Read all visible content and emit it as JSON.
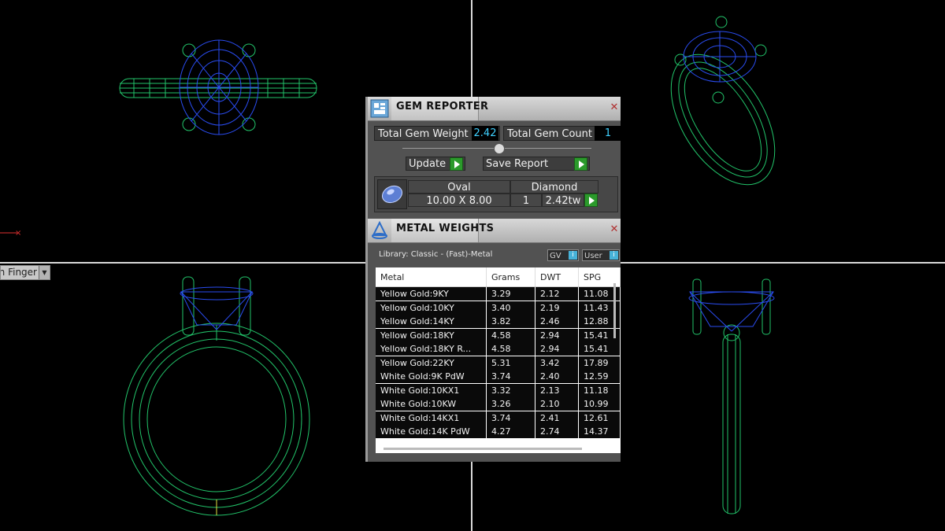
{
  "viewport": {
    "label": "h Finger"
  },
  "gem_reporter": {
    "title": "GEM REPORTER",
    "total_weight_label": "Total Gem Weight",
    "total_weight_value": "2.42",
    "total_count_label": "Total Gem Count",
    "total_count_value": "1",
    "update_label": "Update",
    "save_report_label": "Save Report",
    "gem": {
      "shape": "Oval",
      "type": "Diamond",
      "size": "10.00 X 8.00",
      "qty": "1",
      "weight": "2.42tw"
    }
  },
  "metal_weights": {
    "title": "METAL WEIGHTS",
    "library": "Library: Classic - (Fast)-Metal",
    "gv_label": "GV",
    "user_label": "User",
    "columns": [
      "Metal",
      "Grams",
      "DWT",
      "SPG"
    ],
    "rows": [
      [
        "Yellow Gold:9KY",
        "3.29",
        "2.12",
        "11.08"
      ],
      [
        "Yellow Gold:10KY",
        "3.40",
        "2.19",
        "11.43"
      ],
      [
        "Yellow Gold:14KY",
        "3.82",
        "2.46",
        "12.88"
      ],
      [
        "Yellow Gold:18KY",
        "4.58",
        "2.94",
        "15.41"
      ],
      [
        "Yellow Gold:18KY R...",
        "4.58",
        "2.94",
        "15.41"
      ],
      [
        "Yellow Gold:22KY",
        "5.31",
        "3.42",
        "17.89"
      ],
      [
        "White Gold:9K PdW",
        "3.74",
        "2.40",
        "12.59"
      ],
      [
        "White Gold:10KX1",
        "3.32",
        "2.13",
        "11.18"
      ],
      [
        "White Gold:10KW",
        "3.26",
        "2.10",
        "10.99"
      ],
      [
        "White Gold:14KX1",
        "3.74",
        "2.41",
        "12.61"
      ],
      [
        "White Gold:14K PdW",
        "4.27",
        "2.74",
        "14.37"
      ]
    ]
  },
  "colors": {
    "band_wire": "#22c46a",
    "stone_wire": "#2a4cf0",
    "value_text": "#3fd0ff",
    "go_button": "#2b9a2b"
  },
  "icons": [
    "gem-reporter-icon",
    "metal-weights-icon",
    "close-icon",
    "arrow-right-icon",
    "info-icon",
    "dropdown-icon"
  ]
}
